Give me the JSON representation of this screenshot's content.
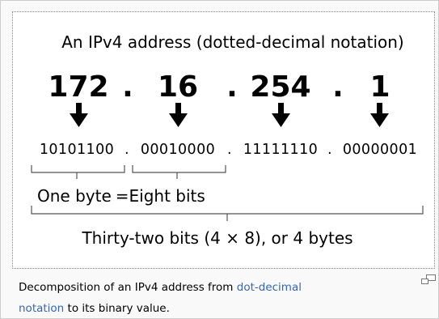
{
  "diagram": {
    "heading": "An IPv4 address (dotted-decimal notation)",
    "octets": [
      "172",
      "16",
      "254",
      "1"
    ],
    "dot": ".",
    "binary": [
      "10101100",
      "00010000",
      "11111110",
      "00000001"
    ],
    "binary_separator": ".",
    "byte_label": "One byte",
    "equals": "=",
    "bits_label": "Eight bits",
    "total_label": "Thirty-two bits (4 × 8), or 4 bytes"
  },
  "caption": {
    "text_before": "Decomposition of an IPv4 address from ",
    "link1": "dot-decimal",
    "link2": "notation",
    "text_after": " to its binary value."
  },
  "colors": {
    "link": "#3366bb",
    "frame_border": "#7a8aa0"
  },
  "icons": {
    "enlarge": "magnify-icon"
  }
}
